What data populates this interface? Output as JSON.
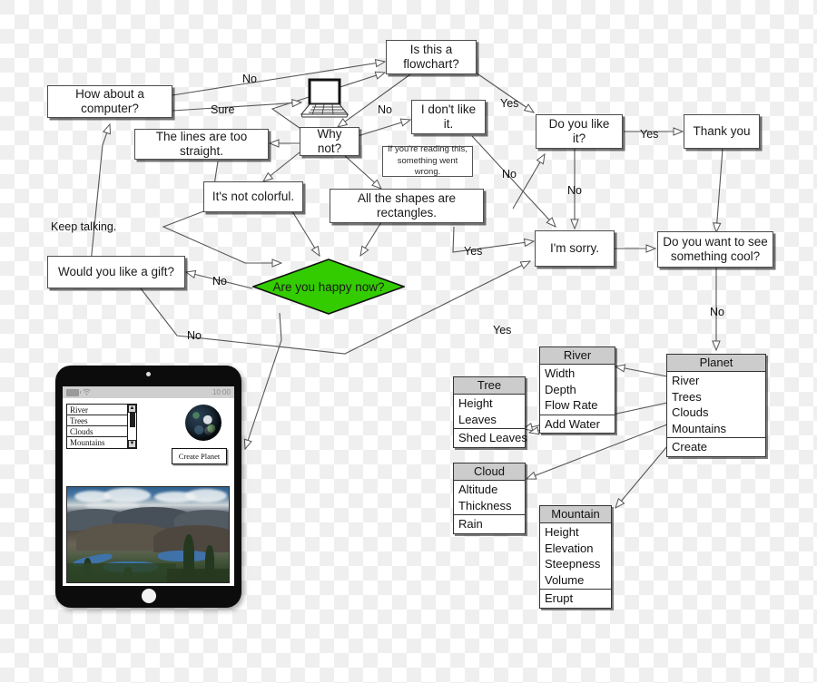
{
  "diagram": {
    "title": "Flowchart with UML class diagram and tablet mockup"
  },
  "nodes": {
    "is_flowchart": "Is this a flowchart?",
    "how_about_computer": "How about a computer?",
    "lines_too_straight": "The lines are too straight.",
    "why_not": "Why not?",
    "dont_like_it": "I don't like it.",
    "error_note_line1": "If you're reading this,",
    "error_note_line2": "something went wrong.",
    "not_colorful": "It's not colorful.",
    "all_rectangles": "All the shapes are rectangles.",
    "do_you_like_it": "Do you like it?",
    "thank_you": "Thank you",
    "im_sorry": "I'm sorry.",
    "see_something_cool_line1": "Do you want to see",
    "see_something_cool_line2": "something cool?",
    "would_you_like_gift": "Would you like a gift?",
    "are_you_happy": "Are you happy now?"
  },
  "edge_labels": {
    "no_top": "No",
    "sure": "Sure",
    "no_why": "No",
    "yes_like": "Yes",
    "yes_thank": "Yes",
    "no_sorry": "No",
    "no_right": "No",
    "keep_talking": "Keep talking.",
    "no_gift": "No",
    "yes_happy": "Yes",
    "no_gift_bottom": "No",
    "yes_tablet": "Yes",
    "no_planet": "No"
  },
  "uml_classes": [
    {
      "name": "River",
      "attributes": [
        "Width",
        "Depth",
        "Flow Rate"
      ],
      "operations": [
        "Add Water"
      ]
    },
    {
      "name": "Tree",
      "attributes": [
        "Height",
        "Leaves"
      ],
      "operations": [
        "Shed Leaves"
      ]
    },
    {
      "name": "Planet",
      "attributes": [
        "River",
        "Trees",
        "Clouds",
        "Mountains"
      ],
      "operations": [
        "Create"
      ]
    },
    {
      "name": "Cloud",
      "attributes": [
        "Altitude",
        "Thickness"
      ],
      "operations": [
        "Rain"
      ]
    },
    {
      "name": "Mountain",
      "attributes": [
        "Height",
        "Elevation",
        "Steepness",
        "Volume"
      ],
      "operations": [
        "Erupt"
      ]
    }
  ],
  "tablet": {
    "status_time": "10:00",
    "battery_icon": "battery-icon",
    "wifi_icon": "wifi-icon",
    "list_items": [
      "River",
      "Trees",
      "Clouds",
      "Mountains"
    ],
    "scroll_up": "▲",
    "scroll_down": "▼",
    "create_button": "Create Planet",
    "globe_icon": "globe-icon",
    "landscape_image": "mountain-landscape-photo"
  },
  "icons": {
    "laptop": "laptop-icon"
  },
  "colors": {
    "diamond_fill": "#33cc00",
    "diamond_stroke": "#111111",
    "node_border": "#4d4d4d",
    "uml_header": "#cccccc",
    "line": "#555555"
  }
}
